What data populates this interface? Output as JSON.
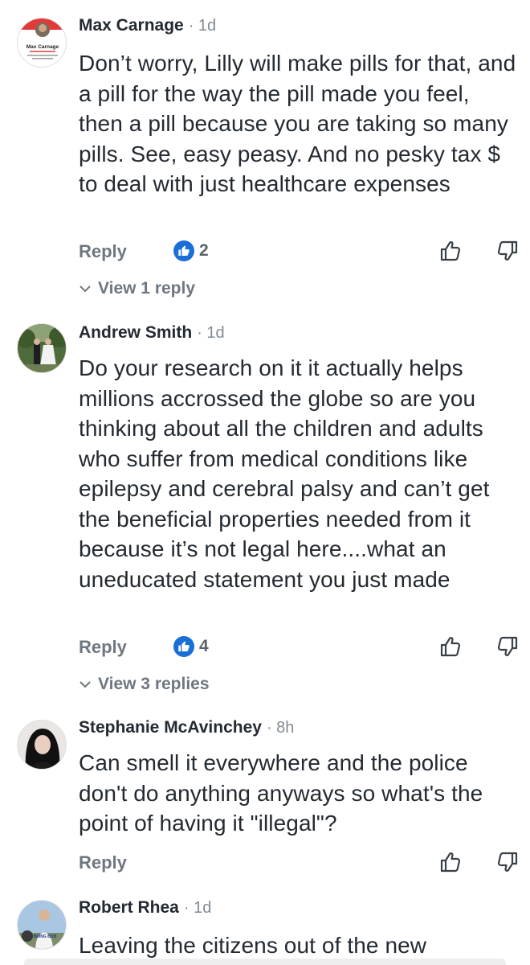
{
  "comments": [
    {
      "name": "Max Carnage",
      "time": "· 1d",
      "avatar_icon": "profile-card-icon",
      "avatar_label": "Max Carnage",
      "text": "Don’t worry, Lilly will make pills for that, and a pill for the way the pill made you feel, then a pill because you are taking so many pills.  See, easy peasy.  And no pesky tax $ to deal with just healthcare expenses",
      "reply_label": "Reply",
      "like_count": "2",
      "view_replies": "View 1 reply"
    },
    {
      "name": "Andrew Smith",
      "time": "· 1d",
      "avatar_icon": "wedding-photo-icon",
      "text": "Do your research on it it actually helps millions accrossed the globe so are you thinking about all the children and adults who suffer from medical conditions like epilepsy and cerebral palsy and can’t get the beneficial properties needed from it because it’s not legal here....what an uneducated statement you just made",
      "reply_label": "Reply",
      "like_count": "4",
      "view_replies": "View 3 replies"
    },
    {
      "name": "Stephanie McAvinchey",
      "time": "· 8h",
      "avatar_icon": "portrait-photo-icon",
      "text": "Can smell it everywhere and the police don't do anything anyways so what's the point of having it \"illegal\"?",
      "reply_label": "Reply"
    },
    {
      "name": "Robert Rhea",
      "time": "· 1d",
      "avatar_icon": "outdoor-photo-icon",
      "avatar_label": "BRING BOB",
      "text": "Leaving the citizens out of the new"
    }
  ],
  "colors": {
    "like_badge": "#1a6fd6",
    "muted_text": "#6e7780",
    "body_text": "#232a31"
  }
}
